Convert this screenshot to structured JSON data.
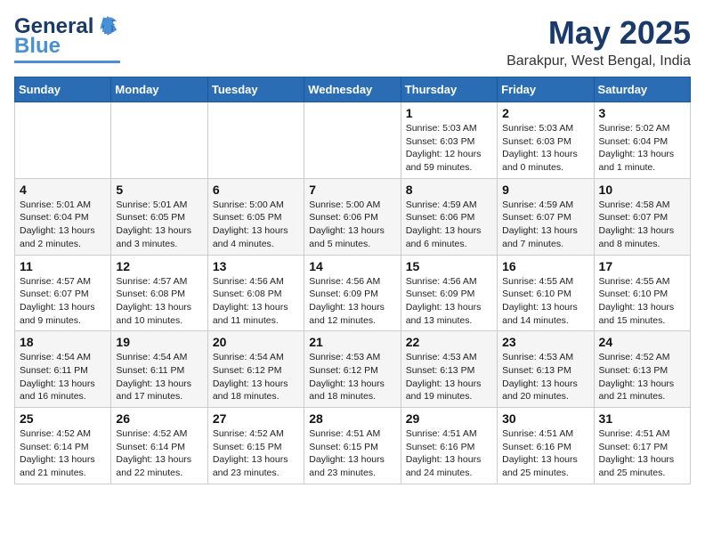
{
  "logo": {
    "line1": "General",
    "line2": "Blue"
  },
  "title": "May 2025",
  "location": "Barakpur, West Bengal, India",
  "days_of_week": [
    "Sunday",
    "Monday",
    "Tuesday",
    "Wednesday",
    "Thursday",
    "Friday",
    "Saturday"
  ],
  "weeks": [
    [
      {
        "day": "",
        "info": ""
      },
      {
        "day": "",
        "info": ""
      },
      {
        "day": "",
        "info": ""
      },
      {
        "day": "",
        "info": ""
      },
      {
        "day": "1",
        "info": "Sunrise: 5:03 AM\nSunset: 6:03 PM\nDaylight: 12 hours\nand 59 minutes."
      },
      {
        "day": "2",
        "info": "Sunrise: 5:03 AM\nSunset: 6:03 PM\nDaylight: 13 hours\nand 0 minutes."
      },
      {
        "day": "3",
        "info": "Sunrise: 5:02 AM\nSunset: 6:04 PM\nDaylight: 13 hours\nand 1 minute."
      }
    ],
    [
      {
        "day": "4",
        "info": "Sunrise: 5:01 AM\nSunset: 6:04 PM\nDaylight: 13 hours\nand 2 minutes."
      },
      {
        "day": "5",
        "info": "Sunrise: 5:01 AM\nSunset: 6:05 PM\nDaylight: 13 hours\nand 3 minutes."
      },
      {
        "day": "6",
        "info": "Sunrise: 5:00 AM\nSunset: 6:05 PM\nDaylight: 13 hours\nand 4 minutes."
      },
      {
        "day": "7",
        "info": "Sunrise: 5:00 AM\nSunset: 6:06 PM\nDaylight: 13 hours\nand 5 minutes."
      },
      {
        "day": "8",
        "info": "Sunrise: 4:59 AM\nSunset: 6:06 PM\nDaylight: 13 hours\nand 6 minutes."
      },
      {
        "day": "9",
        "info": "Sunrise: 4:59 AM\nSunset: 6:07 PM\nDaylight: 13 hours\nand 7 minutes."
      },
      {
        "day": "10",
        "info": "Sunrise: 4:58 AM\nSunset: 6:07 PM\nDaylight: 13 hours\nand 8 minutes."
      }
    ],
    [
      {
        "day": "11",
        "info": "Sunrise: 4:57 AM\nSunset: 6:07 PM\nDaylight: 13 hours\nand 9 minutes."
      },
      {
        "day": "12",
        "info": "Sunrise: 4:57 AM\nSunset: 6:08 PM\nDaylight: 13 hours\nand 10 minutes."
      },
      {
        "day": "13",
        "info": "Sunrise: 4:56 AM\nSunset: 6:08 PM\nDaylight: 13 hours\nand 11 minutes."
      },
      {
        "day": "14",
        "info": "Sunrise: 4:56 AM\nSunset: 6:09 PM\nDaylight: 13 hours\nand 12 minutes."
      },
      {
        "day": "15",
        "info": "Sunrise: 4:56 AM\nSunset: 6:09 PM\nDaylight: 13 hours\nand 13 minutes."
      },
      {
        "day": "16",
        "info": "Sunrise: 4:55 AM\nSunset: 6:10 PM\nDaylight: 13 hours\nand 14 minutes."
      },
      {
        "day": "17",
        "info": "Sunrise: 4:55 AM\nSunset: 6:10 PM\nDaylight: 13 hours\nand 15 minutes."
      }
    ],
    [
      {
        "day": "18",
        "info": "Sunrise: 4:54 AM\nSunset: 6:11 PM\nDaylight: 13 hours\nand 16 minutes."
      },
      {
        "day": "19",
        "info": "Sunrise: 4:54 AM\nSunset: 6:11 PM\nDaylight: 13 hours\nand 17 minutes."
      },
      {
        "day": "20",
        "info": "Sunrise: 4:54 AM\nSunset: 6:12 PM\nDaylight: 13 hours\nand 18 minutes."
      },
      {
        "day": "21",
        "info": "Sunrise: 4:53 AM\nSunset: 6:12 PM\nDaylight: 13 hours\nand 18 minutes."
      },
      {
        "day": "22",
        "info": "Sunrise: 4:53 AM\nSunset: 6:13 PM\nDaylight: 13 hours\nand 19 minutes."
      },
      {
        "day": "23",
        "info": "Sunrise: 4:53 AM\nSunset: 6:13 PM\nDaylight: 13 hours\nand 20 minutes."
      },
      {
        "day": "24",
        "info": "Sunrise: 4:52 AM\nSunset: 6:13 PM\nDaylight: 13 hours\nand 21 minutes."
      }
    ],
    [
      {
        "day": "25",
        "info": "Sunrise: 4:52 AM\nSunset: 6:14 PM\nDaylight: 13 hours\nand 21 minutes."
      },
      {
        "day": "26",
        "info": "Sunrise: 4:52 AM\nSunset: 6:14 PM\nDaylight: 13 hours\nand 22 minutes."
      },
      {
        "day": "27",
        "info": "Sunrise: 4:52 AM\nSunset: 6:15 PM\nDaylight: 13 hours\nand 23 minutes."
      },
      {
        "day": "28",
        "info": "Sunrise: 4:51 AM\nSunset: 6:15 PM\nDaylight: 13 hours\nand 23 minutes."
      },
      {
        "day": "29",
        "info": "Sunrise: 4:51 AM\nSunset: 6:16 PM\nDaylight: 13 hours\nand 24 minutes."
      },
      {
        "day": "30",
        "info": "Sunrise: 4:51 AM\nSunset: 6:16 PM\nDaylight: 13 hours\nand 25 minutes."
      },
      {
        "day": "31",
        "info": "Sunrise: 4:51 AM\nSunset: 6:17 PM\nDaylight: 13 hours\nand 25 minutes."
      }
    ]
  ]
}
